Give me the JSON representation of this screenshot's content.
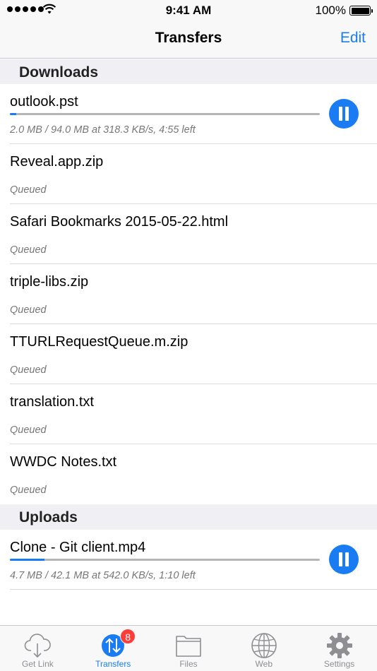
{
  "status_bar": {
    "time": "9:41 AM",
    "battery": "100%"
  },
  "nav": {
    "title": "Transfers",
    "edit_label": "Edit"
  },
  "downloads": {
    "header": "Downloads",
    "items": [
      {
        "name": "outlook.pst",
        "detail": "2.0 MB / 94.0 MB at 318.3 KB/s, 4:55 left",
        "progress": 0.021,
        "active": true
      },
      {
        "name": "Reveal.app.zip",
        "detail": "Queued"
      },
      {
        "name": "Safari Bookmarks 2015-05-22.html",
        "detail": "Queued"
      },
      {
        "name": "triple-libs.zip",
        "detail": "Queued"
      },
      {
        "name": "TTURLRequestQueue.m.zip",
        "detail": "Queued"
      },
      {
        "name": "translation.txt",
        "detail": "Queued"
      },
      {
        "name": "WWDC Notes.txt",
        "detail": "Queued"
      }
    ]
  },
  "uploads": {
    "header": "Uploads",
    "items": [
      {
        "name": "Clone - Git client.mp4",
        "detail": "4.7 MB / 42.1 MB at 542.0 KB/s, 1:10 left",
        "progress": 0.112,
        "active": true
      }
    ]
  },
  "tab_bar": {
    "tabs": [
      {
        "label": "Get Link",
        "icon": "cloud-download-icon"
      },
      {
        "label": "Transfers",
        "icon": "transfers-icon",
        "badge": "8",
        "active": true
      },
      {
        "label": "Files",
        "icon": "folder-icon"
      },
      {
        "label": "Web",
        "icon": "globe-icon"
      },
      {
        "label": "Settings",
        "icon": "gear-icon"
      }
    ]
  },
  "colors": {
    "accent": "#1a7cf2",
    "badge": "#fc3d39",
    "section_bg": "#efeff4"
  }
}
